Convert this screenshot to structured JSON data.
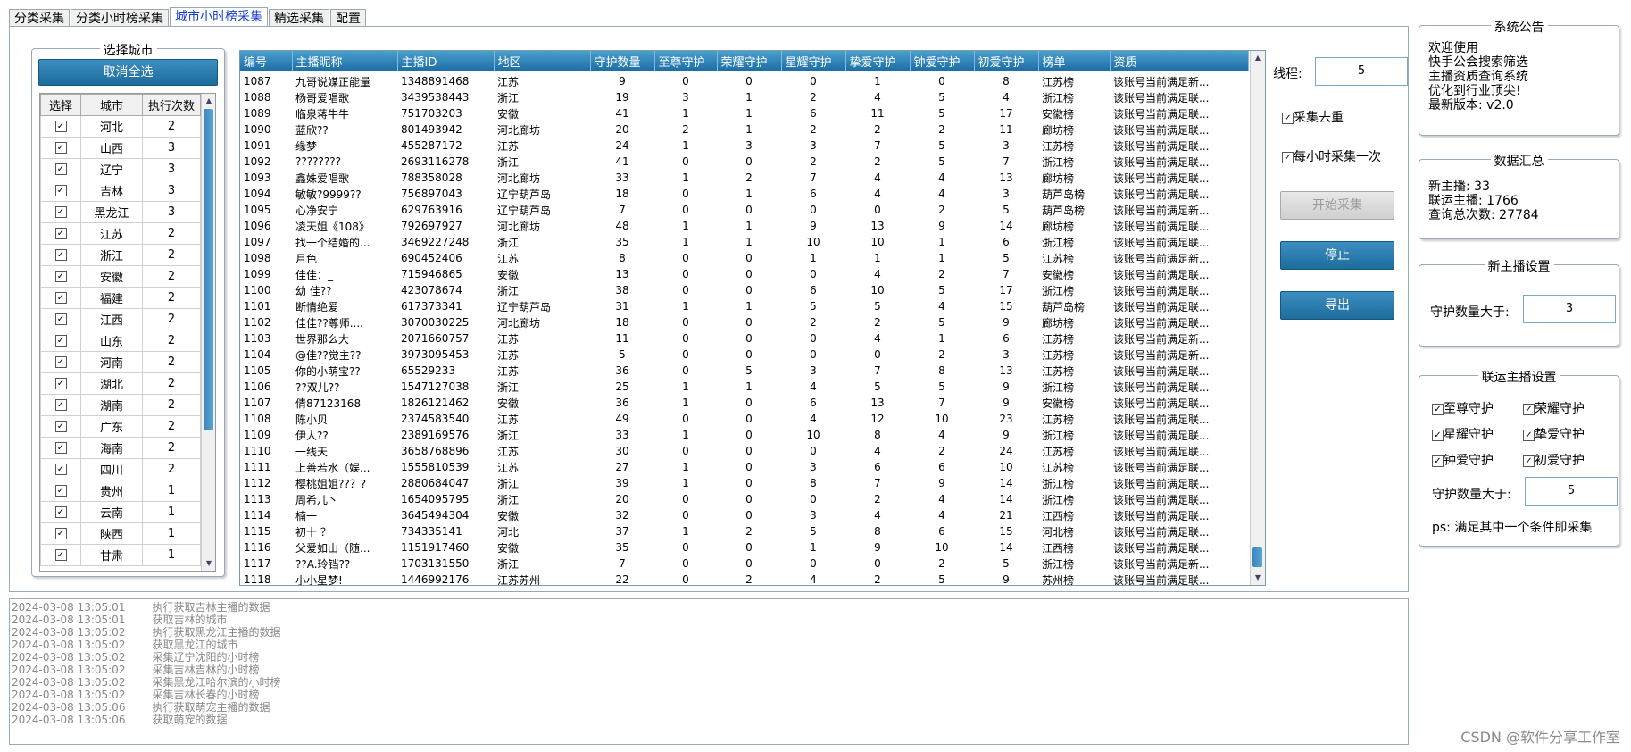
{
  "tabs": [
    "分类采集",
    "分类小时榜采集",
    "城市小时榜采集",
    "精选采集",
    "配置"
  ],
  "active_tab": 2,
  "city_panel": {
    "title": "选择城市",
    "deselect_all": "取消全选",
    "headers": [
      "选择",
      "城市",
      "执行次数"
    ],
    "rows": [
      {
        "city": "河北",
        "count": "2"
      },
      {
        "city": "山西",
        "count": "3"
      },
      {
        "city": "辽宁",
        "count": "3"
      },
      {
        "city": "吉林",
        "count": "3"
      },
      {
        "city": "黑龙江",
        "count": "3"
      },
      {
        "city": "江苏",
        "count": "2"
      },
      {
        "city": "浙江",
        "count": "2"
      },
      {
        "city": "安徽",
        "count": "2"
      },
      {
        "city": "福建",
        "count": "2"
      },
      {
        "city": "江西",
        "count": "2"
      },
      {
        "city": "山东",
        "count": "2"
      },
      {
        "city": "河南",
        "count": "2"
      },
      {
        "city": "湖北",
        "count": "2"
      },
      {
        "city": "湖南",
        "count": "2"
      },
      {
        "city": "广东",
        "count": "2"
      },
      {
        "city": "海南",
        "count": "2"
      },
      {
        "city": "四川",
        "count": "2"
      },
      {
        "city": "贵州",
        "count": "1"
      },
      {
        "city": "云南",
        "count": "1"
      },
      {
        "city": "陕西",
        "count": "1"
      },
      {
        "city": "甘肃",
        "count": "1"
      }
    ]
  },
  "grid": {
    "headers": [
      "编号",
      "主播昵称",
      "主播ID",
      "地区",
      "守护数量",
      "至尊守护",
      "荣耀守护",
      "星耀守护",
      "挚爱守护",
      "钟爱守护",
      "初爱守护",
      "榜单",
      "资质"
    ],
    "rows": [
      [
        "1087",
        "九哥说媒正能量",
        "1348891468",
        "江苏",
        "9",
        "0",
        "0",
        "0",
        "1",
        "0",
        "8",
        "江苏榜",
        "该账号当前满足新..."
      ],
      [
        "1088",
        "杨哥爱唱歌",
        "3439538443",
        "浙江",
        "19",
        "3",
        "1",
        "2",
        "4",
        "5",
        "4",
        "浙江榜",
        "该账号当前满足联..."
      ],
      [
        "1089",
        "临泉蒋牛牛",
        "751703203",
        "安徽",
        "41",
        "1",
        "1",
        "6",
        "11",
        "5",
        "17",
        "安徽榜",
        "该账号当前满足联..."
      ],
      [
        "1090",
        "蓝欣??",
        "801493942",
        "河北廊坊",
        "20",
        "2",
        "1",
        "2",
        "2",
        "2",
        "11",
        "廊坊榜",
        "该账号当前满足联..."
      ],
      [
        "1091",
        "缘梦",
        "455287172",
        "江苏",
        "24",
        "1",
        "3",
        "3",
        "7",
        "5",
        "3",
        "江苏榜",
        "该账号当前满足联..."
      ],
      [
        "1092",
        "????????",
        "2693116278",
        "浙江",
        "41",
        "0",
        "0",
        "2",
        "2",
        "5",
        "7",
        "浙江榜",
        "该账号当前满足联..."
      ],
      [
        "1093",
        "鑫姝爱唱歌",
        "788358028",
        "河北廊坊",
        "33",
        "1",
        "2",
        "7",
        "4",
        "4",
        "13",
        "廊坊榜",
        "该账号当前满足联..."
      ],
      [
        "1094",
        "敏敏?9999??",
        "756897043",
        "辽宁葫芦岛",
        "18",
        "0",
        "1",
        "6",
        "4",
        "4",
        "3",
        "葫芦岛榜",
        "该账号当前满足联..."
      ],
      [
        "1095",
        "心净安宁",
        "629763916",
        "辽宁葫芦岛",
        "7",
        "0",
        "0",
        "0",
        "0",
        "2",
        "5",
        "葫芦岛榜",
        "该账号当前满足新..."
      ],
      [
        "1096",
        "凌天姐《108》",
        "792697927",
        "河北廊坊",
        "48",
        "1",
        "1",
        "9",
        "13",
        "9",
        "14",
        "廊坊榜",
        "该账号当前满足联..."
      ],
      [
        "1097",
        "找一个结婚的...",
        "3469227248",
        "浙江",
        "35",
        "1",
        "1",
        "10",
        "10",
        "1",
        "6",
        "浙江榜",
        "该账号当前满足联..."
      ],
      [
        "1098",
        "月色",
        "690452406",
        "江苏",
        "8",
        "0",
        "0",
        "1",
        "1",
        "1",
        "5",
        "江苏榜",
        "该账号当前满足新..."
      ],
      [
        "1099",
        "佳佳：_",
        "715946865",
        "安徽",
        "13",
        "0",
        "0",
        "0",
        "4",
        "2",
        "7",
        "安徽榜",
        "该账号当前满足联..."
      ],
      [
        "1100",
        "幼 佳??",
        "423078674",
        "浙江",
        "38",
        "0",
        "0",
        "6",
        "10",
        "5",
        "17",
        "浙江榜",
        "该账号当前满足联..."
      ],
      [
        "1101",
        "断情绝爱",
        "617373341",
        "辽宁葫芦岛",
        "31",
        "1",
        "1",
        "5",
        "5",
        "4",
        "15",
        "葫芦岛榜",
        "该账号当前满足联..."
      ],
      [
        "1102",
        "佳佳??尊师....",
        "3070030225",
        "河北廊坊",
        "18",
        "0",
        "0",
        "2",
        "2",
        "5",
        "9",
        "廊坊榜",
        "该账号当前满足联..."
      ],
      [
        "1103",
        "世界那么大",
        "2071660757",
        "江苏",
        "11",
        "0",
        "0",
        "0",
        "4",
        "1",
        "6",
        "江苏榜",
        "该账号当前满足新..."
      ],
      [
        "1104",
        "@佳??觉主??",
        "3973095453",
        "江苏",
        "5",
        "0",
        "0",
        "0",
        "0",
        "2",
        "3",
        "江苏榜",
        "该账号当前满足新..."
      ],
      [
        "1105",
        "你的小萌宝??",
        "65529233",
        "江苏",
        "36",
        "0",
        "5",
        "3",
        "7",
        "8",
        "13",
        "江苏榜",
        "该账号当前满足联..."
      ],
      [
        "1106",
        "??双儿??",
        "1547127038",
        "浙江",
        "25",
        "1",
        "1",
        "4",
        "5",
        "5",
        "9",
        "浙江榜",
        "该账号当前满足联..."
      ],
      [
        "1107",
        "倩87123168",
        "1826121462",
        "安徽",
        "36",
        "1",
        "0",
        "6",
        "13",
        "7",
        "9",
        "安徽榜",
        "该账号当前满足联..."
      ],
      [
        "1108",
        "陈小贝",
        "2374583540",
        "江苏",
        "49",
        "0",
        "0",
        "4",
        "12",
        "10",
        "23",
        "江苏榜",
        "该账号当前满足联..."
      ],
      [
        "1109",
        "伊人??",
        "2389169576",
        "浙江",
        "33",
        "1",
        "0",
        "10",
        "8",
        "4",
        "9",
        "浙江榜",
        "该账号当前满足联..."
      ],
      [
        "1110",
        "一线天",
        "3658768896",
        "江苏",
        "30",
        "0",
        "0",
        "0",
        "4",
        "2",
        "24",
        "江苏榜",
        "该账号当前满足联..."
      ],
      [
        "1111",
        "上善若水（娱...",
        "1555810539",
        "江苏",
        "27",
        "1",
        "0",
        "3",
        "6",
        "6",
        "10",
        "江苏榜",
        "该账号当前满足联..."
      ],
      [
        "1112",
        "樱桃姐姐??？?",
        "2880684047",
        "浙江",
        "39",
        "1",
        "0",
        "8",
        "7",
        "9",
        "14",
        "浙江榜",
        "该账号当前满足联..."
      ],
      [
        "1113",
        "周希儿丶",
        "1654095795",
        "浙江",
        "20",
        "0",
        "0",
        "0",
        "2",
        "4",
        "14",
        "浙江榜",
        "该账号当前满足联..."
      ],
      [
        "1114",
        "楠一",
        "3645494304",
        "安徽",
        "32",
        "0",
        "0",
        "3",
        "4",
        "4",
        "21",
        "江西榜",
        "该账号当前满足联..."
      ],
      [
        "1115",
        "初十 ？",
        "734335141",
        "河北",
        "37",
        "1",
        "2",
        "5",
        "8",
        "6",
        "15",
        "河北榜",
        "该账号当前满足联..."
      ],
      [
        "1116",
        "父爱如山（随...",
        "1151917460",
        "安徽",
        "35",
        "0",
        "0",
        "1",
        "9",
        "10",
        "14",
        "江西榜",
        "该账号当前满足联..."
      ],
      [
        "1117",
        "??A.玲铛??",
        "1703131550",
        "浙江",
        "7",
        "0",
        "0",
        "0",
        "0",
        "2",
        "5",
        "浙江榜",
        "该账号当前满足新..."
      ],
      [
        "1118",
        "小小星梦!",
        "1446992176",
        "江苏苏州",
        "22",
        "0",
        "2",
        "4",
        "2",
        "5",
        "9",
        "苏州榜",
        "该账号当前满足联..."
      ]
    ]
  },
  "controls": {
    "threads_label": "线程:",
    "threads_value": "5",
    "dedupe_label": "采集去重",
    "hourly_label": "每小时采集一次",
    "start_label": "开始采集",
    "stop_label": "停止",
    "export_label": "导出"
  },
  "announcement": {
    "title": "系统公告",
    "lines": [
      "欢迎使用",
      "快手公会搜索筛选",
      "主播资质查询系统",
      "优化到行业顶尖!",
      "最新版本: v2.0"
    ]
  },
  "summary": {
    "title": "数据汇总",
    "lines": [
      "新主播: 33",
      "联运主播: 1766",
      "查询总次数: 27784"
    ]
  },
  "new_anchor": {
    "title": "新主播设置",
    "label": "守护数量大于:",
    "value": "3"
  },
  "linked_anchor": {
    "title": "联运主播设置",
    "checks": [
      "至尊守护",
      "荣耀守护",
      "星耀守护",
      "挚爱守护",
      "钟爱守护",
      "初爱守护"
    ],
    "label": "守护数量大于:",
    "value": "5",
    "note": "ps: 满足其中一个条件即采集"
  },
  "log": [
    {
      "time": "2024-03-08 13:05:01",
      "msg": "执行获取吉林主播的数据"
    },
    {
      "time": "2024-03-08 13:05:01",
      "msg": "获取吉林的城市"
    },
    {
      "time": "2024-03-08 13:05:02",
      "msg": "执行获取黑龙江主播的数据"
    },
    {
      "time": "2024-03-08 13:05:02",
      "msg": "获取黑龙江的城市"
    },
    {
      "time": "2024-03-08 13:05:02",
      "msg": "采集辽宁沈阳的小时榜"
    },
    {
      "time": "2024-03-08 13:05:02",
      "msg": "采集吉林吉林的小时榜"
    },
    {
      "time": "2024-03-08 13:05:02",
      "msg": "采集黑龙江哈尔滨的小时榜"
    },
    {
      "time": "2024-03-08 13:05:02",
      "msg": "采集吉林长春的小时榜"
    },
    {
      "time": "2024-03-08 13:05:06",
      "msg": "执行获取萌宠主播的数据"
    },
    {
      "time": "2024-03-08 13:05:06",
      "msg": "获取萌宠的数据"
    }
  ],
  "watermark": "CSDN @软件分享工作室"
}
